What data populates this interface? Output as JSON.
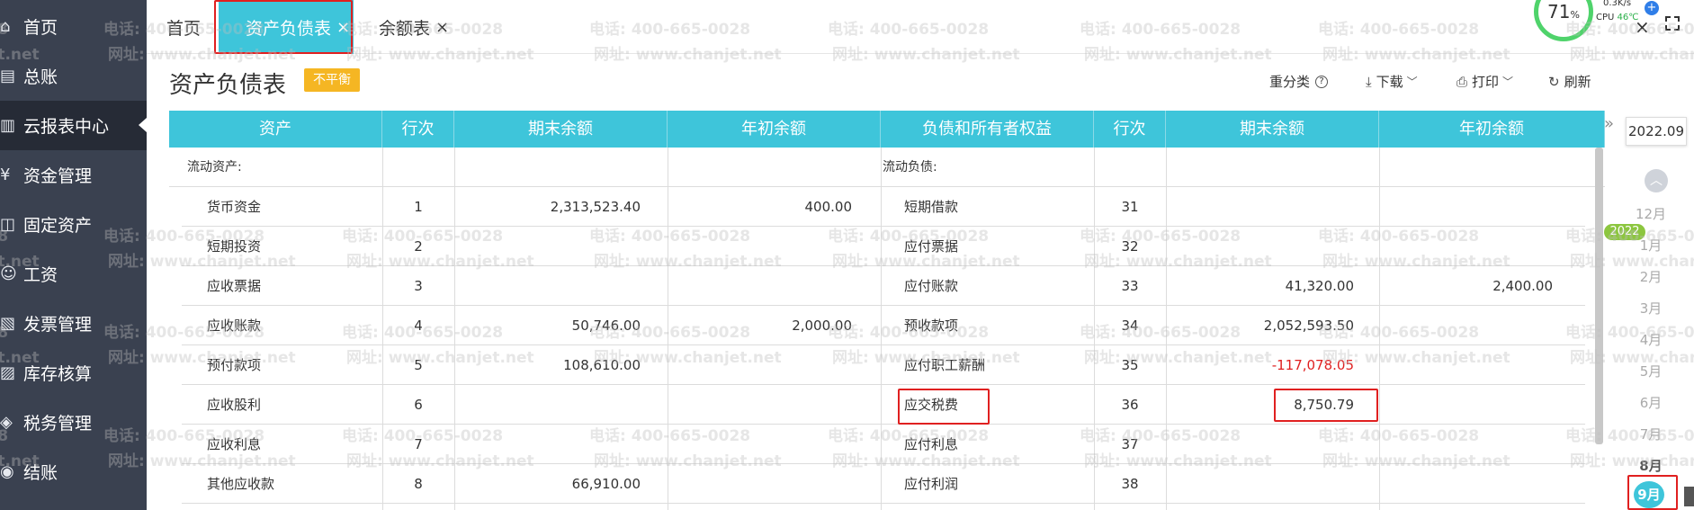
{
  "sidebar": {
    "items": [
      {
        "label": "首页",
        "icon": "home-icon",
        "glyph": "⌂"
      },
      {
        "label": "总账",
        "icon": "ledger-icon",
        "glyph": "▤"
      },
      {
        "label": "云报表中心",
        "icon": "report-center-icon",
        "glyph": "▥",
        "active": true
      },
      {
        "label": "资金管理",
        "icon": "funds-icon",
        "glyph": "¥"
      },
      {
        "label": "固定资产",
        "icon": "fixed-assets-icon",
        "glyph": "◫"
      },
      {
        "label": "工资",
        "icon": "salary-icon",
        "glyph": "☺"
      },
      {
        "label": "发票管理",
        "icon": "invoice-icon",
        "glyph": "▧"
      },
      {
        "label": "库存核算",
        "icon": "inventory-icon",
        "glyph": "▨"
      },
      {
        "label": "税务管理",
        "icon": "tax-icon",
        "glyph": "◈"
      },
      {
        "label": "结账",
        "icon": "closing-icon",
        "glyph": "◉"
      }
    ]
  },
  "tabs": [
    {
      "label": "首页",
      "closable": false
    },
    {
      "label": "资产负债表",
      "closable": true,
      "active": true
    },
    {
      "label": "余额表",
      "closable": true
    }
  ],
  "tab_close_glyph": "×",
  "system_widget": {
    "percent": "71",
    "percent_unit": "%",
    "speed": "0.3K/s",
    "cpu_label": "CPU",
    "cpu_temp": "46℃"
  },
  "page": {
    "title": "资产负债表",
    "status_badge": "不平衡"
  },
  "toolbar": {
    "reclassify": "重分类",
    "download": "下载",
    "print": "打印",
    "refresh": "刷新"
  },
  "table": {
    "headers": [
      "资产",
      "行次",
      "期末余额",
      "年初余额",
      "负债和所有者权益",
      "行次",
      "期末余额",
      "年初余额"
    ],
    "rows": [
      {
        "asset": "流动资产:",
        "a_line": "",
        "a_end": "",
        "a_begin": "",
        "liab": "流动负债:",
        "l_line": "",
        "l_end": "",
        "l_begin": "",
        "section": true
      },
      {
        "asset": "货币资金",
        "a_line": "1",
        "a_end": "2,313,523.40",
        "a_begin": "400.00",
        "liab": "短期借款",
        "l_line": "31",
        "l_end": "",
        "l_begin": ""
      },
      {
        "asset": "短期投资",
        "a_line": "2",
        "a_end": "",
        "a_begin": "",
        "liab": "应付票据",
        "l_line": "32",
        "l_end": "",
        "l_begin": ""
      },
      {
        "asset": "应收票据",
        "a_line": "3",
        "a_end": "",
        "a_begin": "",
        "liab": "应付账款",
        "l_line": "33",
        "l_end": "41,320.00",
        "l_begin": "2,400.00"
      },
      {
        "asset": "应收账款",
        "a_line": "4",
        "a_end": "50,746.00",
        "a_begin": "2,000.00",
        "liab": "预收款项",
        "l_line": "34",
        "l_end": "2,052,593.50",
        "l_begin": ""
      },
      {
        "asset": "预付款项",
        "a_line": "5",
        "a_end": "108,610.00",
        "a_begin": "",
        "liab": "应付职工薪酬",
        "l_line": "35",
        "l_end": "-117,078.05",
        "l_begin": "",
        "negative": true
      },
      {
        "asset": "应收股利",
        "a_line": "6",
        "a_end": "",
        "a_begin": "",
        "liab": "应交税费",
        "l_line": "36",
        "l_end": "8,750.79",
        "l_begin": "",
        "highlight": true
      },
      {
        "asset": "应收利息",
        "a_line": "7",
        "a_end": "",
        "a_begin": "",
        "liab": "应付利息",
        "l_line": "37",
        "l_end": "",
        "l_begin": ""
      },
      {
        "asset": "其他应收款",
        "a_line": "8",
        "a_end": "66,910.00",
        "a_begin": "",
        "liab": "应付利润",
        "l_line": "38",
        "l_end": "",
        "l_begin": ""
      }
    ]
  },
  "period_selector": {
    "expand_glyph": "»",
    "up_glyph": "︿",
    "current_period": "2022.09",
    "year_badge": "2022",
    "months": [
      "12月",
      "1月",
      "2月",
      "3月",
      "4月",
      "5月",
      "6月",
      "7月",
      "8月"
    ],
    "done_months": [
      "8月"
    ],
    "current_month": "9月"
  },
  "watermark": {
    "phone": "电话: 400-665-0028",
    "site": "网址: www.chanjet.net"
  },
  "colors": {
    "accent": "#3ec5da",
    "sidebar": "#3a4150",
    "sidebar_active": "#262b36",
    "warning": "#f5b623",
    "negative": "#e02020",
    "highlight_box": "#e02020",
    "year_badge": "#8cc63f"
  }
}
